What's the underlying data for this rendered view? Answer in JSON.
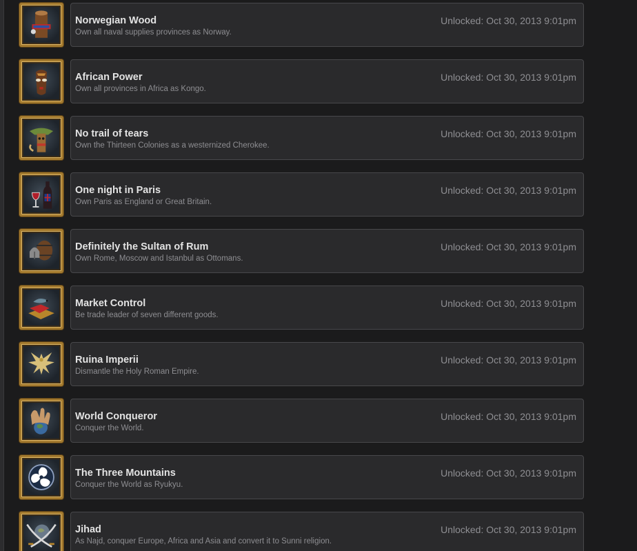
{
  "achievements": [
    {
      "title": "Norwegian Wood",
      "description": "Own all naval supplies provinces as Norway.",
      "unlocked": "Unlocked: Oct 30, 2013 9:01pm",
      "icon": "norwegian-wood-icon"
    },
    {
      "title": "African Power",
      "description": "Own all provinces in Africa as Kongo.",
      "unlocked": "Unlocked: Oct 30, 2013 9:01pm",
      "icon": "african-mask-icon"
    },
    {
      "title": "No trail of tears",
      "description": "Own the Thirteen Colonies as a westernized Cherokee.",
      "unlocked": "Unlocked: Oct 30, 2013 9:01pm",
      "icon": "totem-icon"
    },
    {
      "title": "One night in Paris",
      "description": "Own Paris as England or Great Britain.",
      "unlocked": "Unlocked: Oct 30, 2013 9:01pm",
      "icon": "wine-bottle-icon"
    },
    {
      "title": "Definitely the Sultan of Rum",
      "description": "Own Rome, Moscow and Istanbul as Ottomans.",
      "unlocked": "Unlocked: Oct 30, 2013 9:01pm",
      "icon": "barrel-helmet-icon"
    },
    {
      "title": "Market Control",
      "description": "Be trade leader of seven different goods.",
      "unlocked": "Unlocked: Oct 30, 2013 9:01pm",
      "icon": "trade-goods-icon"
    },
    {
      "title": "Ruina Imperii",
      "description": "Dismantle the Holy Roman Empire.",
      "unlocked": "Unlocked: Oct 30, 2013 9:01pm",
      "icon": "eagle-icon"
    },
    {
      "title": "World Conqueror",
      "description": "Conquer the World.",
      "unlocked": "Unlocked: Oct 30, 2013 9:01pm",
      "icon": "hand-globe-icon"
    },
    {
      "title": "The Three Mountains",
      "description": "Conquer the World as Ryukyu.",
      "unlocked": "Unlocked: Oct 30, 2013 9:01pm",
      "icon": "tomoe-icon"
    },
    {
      "title": "Jihad",
      "description": "As Najd, conquer Europe, Africa and Asia and convert it to Sunni religion.",
      "unlocked": "Unlocked: Oct 30, 2013 9:01pm",
      "icon": "crossed-swords-globe-icon"
    }
  ]
}
